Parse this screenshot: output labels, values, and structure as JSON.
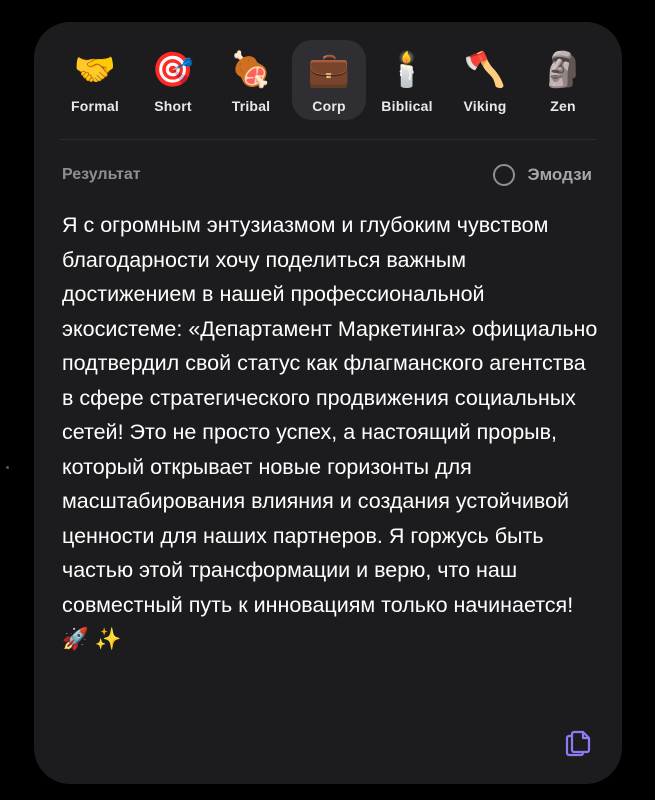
{
  "styles": [
    {
      "label": "Formal",
      "emoji": "🤝"
    },
    {
      "label": "Short",
      "emoji": "🎯"
    },
    {
      "label": "Tribal",
      "emoji": "🍖"
    },
    {
      "label": "Corp",
      "emoji": "💼"
    },
    {
      "label": "Biblical",
      "emoji": "🕯️"
    },
    {
      "label": "Viking",
      "emoji": "🪓"
    },
    {
      "label": "Zen",
      "emoji": "🗿"
    }
  ],
  "selected_style": "Corp",
  "result": {
    "label": "Результат",
    "emoji_toggle_label": "Эмодзи",
    "text": "Я с огромным энтузиазмом и глубоким чувством благодарности хочу поделиться важным достижением в нашей профессиональной экосистеме: «Департамент Маркетинга» официально подтвердил свой статус как флагманского агентства в сфере стратегического продвижения социальных сетей! Это не просто успех, а настоящий прорыв, который открывает новые горизонты для масштабирования влияния и создания устойчивой ценности для наших партнеров. Я горжусь быть частью этой трансформации и верю, что наш совместный путь к инновациям только начинается! 🚀 ✨"
  },
  "icons": {
    "copy": "copy-icon"
  },
  "colors": {
    "card": "#1c1c1e",
    "selected": "#2f2f33",
    "accent": "#8b7cf6"
  }
}
